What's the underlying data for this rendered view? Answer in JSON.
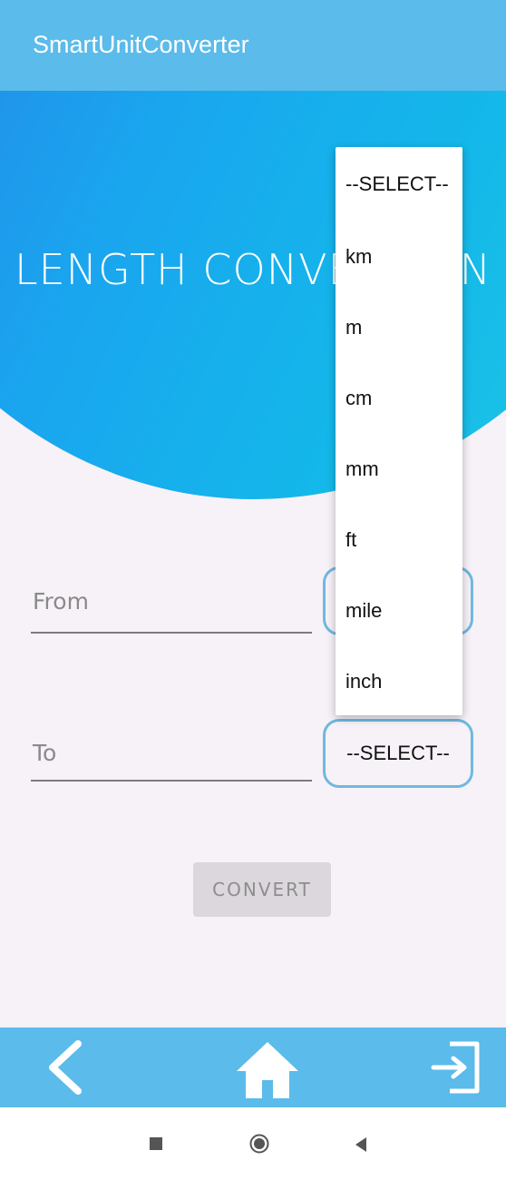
{
  "app_bar": {
    "title": "SmartUnitConverter"
  },
  "hero": {
    "title": "LENGTH CONVERSION"
  },
  "form": {
    "from_placeholder": "From",
    "to_placeholder": "To",
    "to_unit_selected": "--SELECT--",
    "convert_label": "CONVERT"
  },
  "dropdown": {
    "options": [
      "--SELECT--",
      "km",
      "m",
      "cm",
      "mm",
      "ft",
      "mile",
      "inch"
    ]
  },
  "bottom_nav": {
    "icons": [
      "back-chevron-icon",
      "home-icon",
      "logout-icon"
    ]
  },
  "system_nav": {
    "icons": [
      "recent-apps-icon",
      "home-circle-icon",
      "back-triangle-icon"
    ]
  },
  "colors": {
    "primary": "#5bbbea",
    "gradient_start": "#2f6fe0",
    "gradient_end": "#1fcbe2",
    "background": "#f7f1f8",
    "spinner_border": "#6fb9df"
  }
}
